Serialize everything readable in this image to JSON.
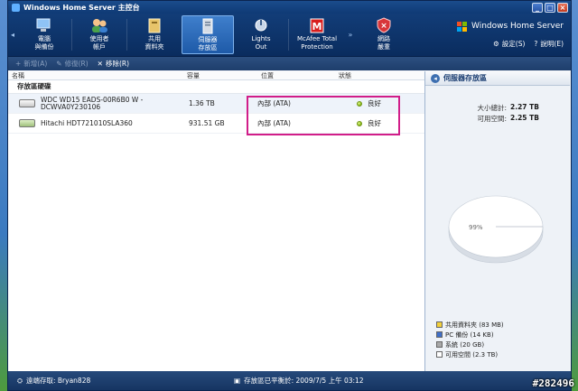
{
  "window": {
    "title": "Windows Home Server 主控台"
  },
  "nav": {
    "tabs": [
      {
        "label1": "電腦",
        "label2": "與備份",
        "icon": "computer-icon"
      },
      {
        "label1": "使用者",
        "label2": "帳戶",
        "icon": "users-icon"
      },
      {
        "label1": "共用",
        "label2": "資料夾",
        "icon": "shared-folder-icon"
      },
      {
        "label1": "伺服器",
        "label2": "存放區",
        "icon": "server-storage-icon"
      },
      {
        "label1": "Lights",
        "label2": "Out",
        "icon": "lights-out-icon"
      },
      {
        "label1": "McAfee Total",
        "label2": "Protection",
        "icon": "mcafee-icon"
      },
      {
        "label1": "網路",
        "label2": "嚴重",
        "icon": "network-critical-icon"
      }
    ],
    "scroll_right": "»",
    "brand": "Windows Home Server",
    "settings_label": "設定(S)",
    "help_label": "說明(E)"
  },
  "toolbar": {
    "add_label": "新增(A)",
    "repair_label": "修復(R)",
    "remove_label": "移除(R)"
  },
  "list": {
    "columns": [
      "名稱",
      "容量",
      "位置",
      "狀態"
    ],
    "group_label": "存放區硬碟",
    "rows": [
      {
        "name_line1": "WDC WD15 EADS-00R6B0   W -",
        "name_line2": "DCWVA0Y230106",
        "capacity": "1.36 TB",
        "location": "內部 (ATA)",
        "status": "良好"
      },
      {
        "name_line1": "Hitachi HDT721010SLA360",
        "name_line2": "",
        "capacity": "931.51 GB",
        "location": "內部 (ATA)",
        "status": "良好"
      }
    ]
  },
  "side": {
    "title": "伺服器存放區",
    "total_label": "大小總計:",
    "total_value": "2.27 TB",
    "free_label": "可用空間:",
    "free_value": "2.25 TB",
    "pie_label": "99%",
    "legend": [
      {
        "label": "共用資料夾 (83 MB)",
        "color": "#f2cf3a"
      },
      {
        "label": "PC 備份 (14 KB)",
        "color": "#3f6fc8"
      },
      {
        "label": "系統 (20 GB)",
        "color": "#a8a8a8"
      },
      {
        "label": "可用空間 (2.3 TB)",
        "color": "#ffffff"
      }
    ]
  },
  "status": {
    "remote_label": "遠端存取: Bryan828",
    "storage_label": "存放區已平衡於: 2009/7/5 上午 03:12"
  },
  "watermark": "#282496"
}
